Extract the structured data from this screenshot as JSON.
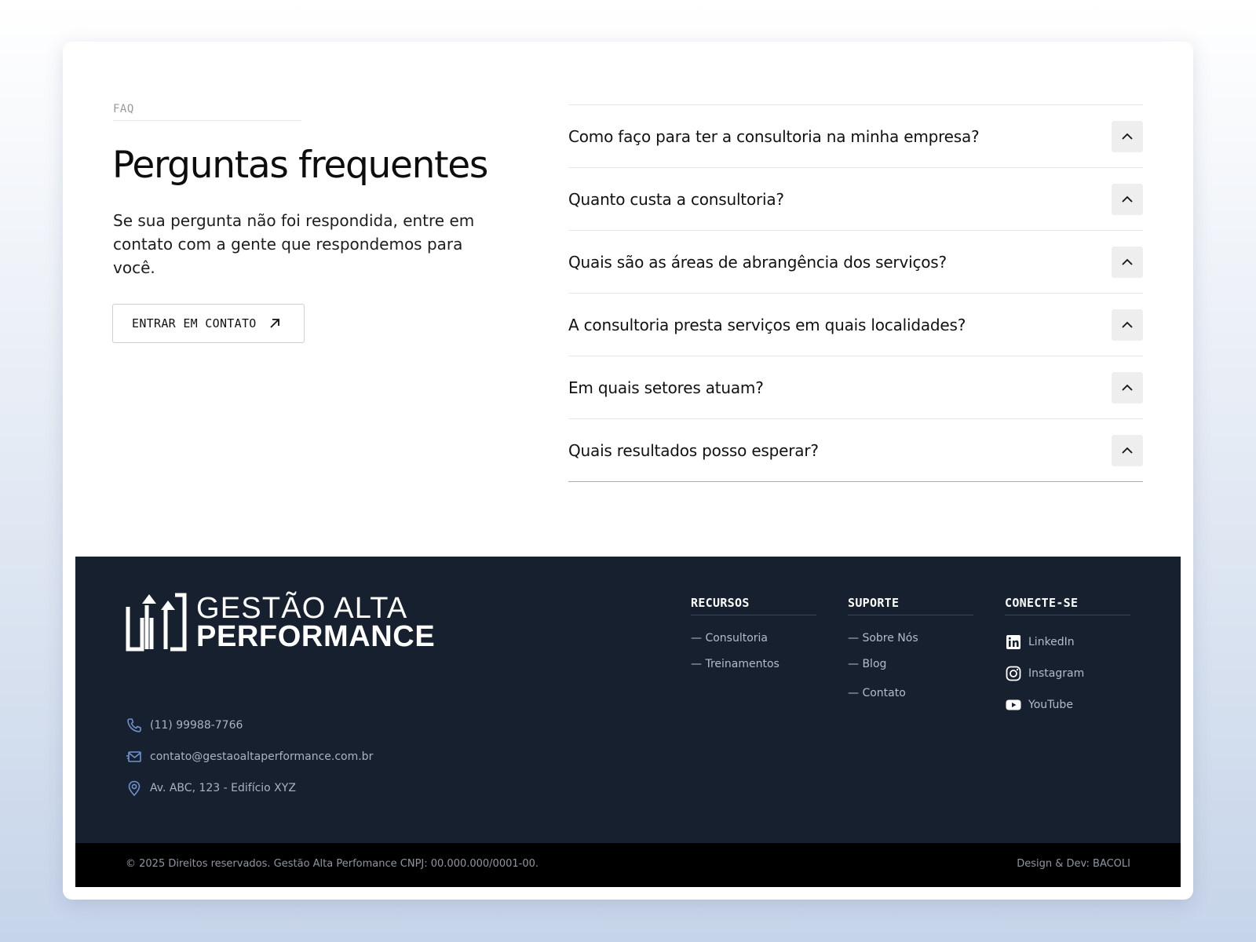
{
  "faq": {
    "eyebrow": "FAQ",
    "title": "Perguntas frequentes",
    "description": "Se sua pergunta não foi respondida, entre em contato com a gente que respondemos para você.",
    "cta_label": "ENTRAR EM CONTATO",
    "questions": [
      "Como faço para ter a consultoria na minha empresa?",
      "Quanto custa a consultoria?",
      "Quais são as áreas de abrangência dos serviços?",
      "A consultoria presta serviços em quais localidades?",
      "Em quais setores atuam?",
      "Quais resultados posso esperar?"
    ]
  },
  "footer": {
    "logo": {
      "line1": "GESTÃO ALTA",
      "line2": "PERFORMANCE"
    },
    "contacts": {
      "phone": "(11) 99988-7766",
      "email": "contato@gestaoaltaperformance.com.br",
      "address": "Av. ABC, 123 - Edifício XYZ"
    },
    "columns": {
      "recursos": {
        "title": "RECURSOS",
        "links": [
          "— Consultoria",
          "— Treinamentos"
        ]
      },
      "suporte": {
        "title": "SUPORTE",
        "links": [
          "— Sobre Nós",
          "— Blog",
          "— Contato"
        ]
      },
      "conecte": {
        "title": "CONECTE-SE",
        "links": [
          "LinkedIn",
          "Instagram",
          "YouTube"
        ]
      }
    },
    "copyright": "© 2025 Direitos reservados. Gestão Alta Perfomance CNPJ: 00.000.000/0001-00.",
    "credit": "Design & Dev: BACOLI"
  },
  "colors": {
    "footer_bg": "#16202f",
    "bottom_bar_bg": "#000000",
    "accent_icon": "#6f93cf"
  },
  "icons": {
    "cta": "arrow-up-right-icon",
    "faq_toggle": "chevron-up-icon",
    "phone": "phone-icon",
    "email": "mail-icon",
    "address": "map-pin-icon",
    "linkedin": "linkedin-icon",
    "instagram": "instagram-icon",
    "youtube": "youtube-icon"
  }
}
